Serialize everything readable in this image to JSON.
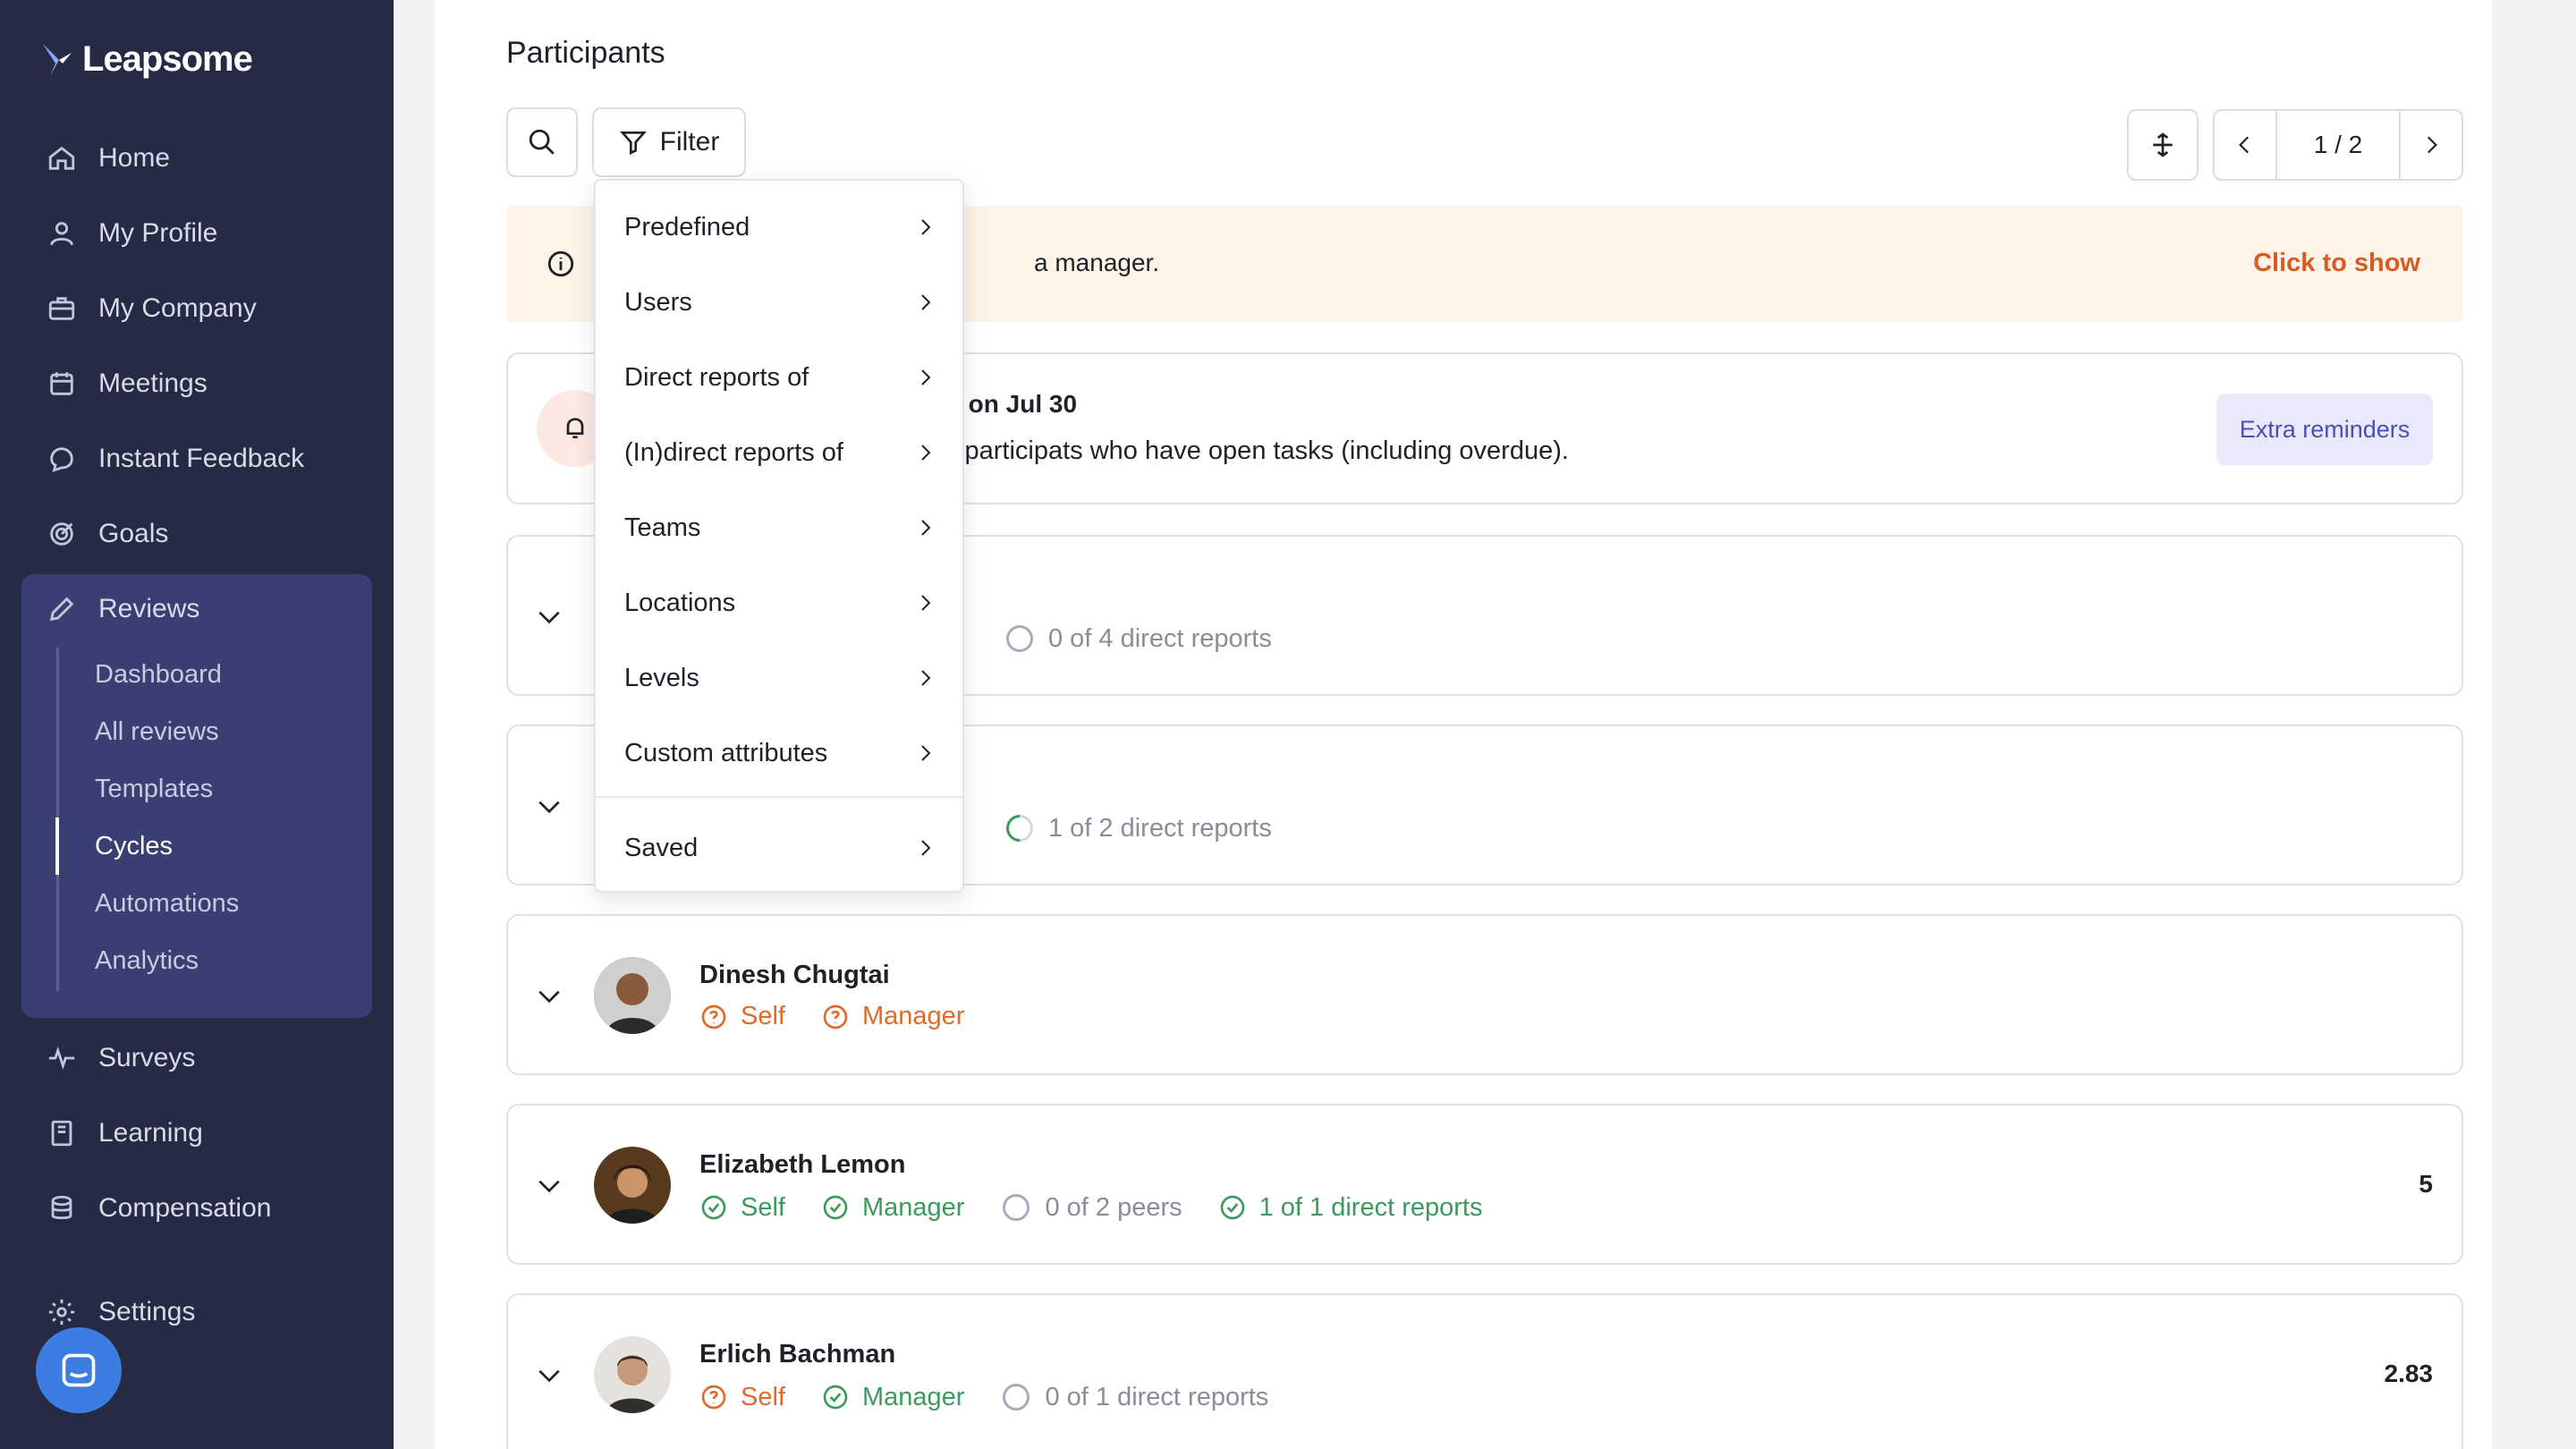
{
  "app": {
    "logo_text": "Leapsome"
  },
  "sidebar": {
    "items": [
      {
        "label": "Home",
        "icon": "home-icon"
      },
      {
        "label": "My Profile",
        "icon": "user-icon"
      },
      {
        "label": "My Company",
        "icon": "briefcase-icon"
      },
      {
        "label": "Meetings",
        "icon": "calendar-icon"
      },
      {
        "label": "Instant Feedback",
        "icon": "chat-icon"
      },
      {
        "label": "Goals",
        "icon": "target-icon"
      },
      {
        "label": "Reviews",
        "icon": "pencil-icon"
      },
      {
        "label": "Surveys",
        "icon": "pulse-icon"
      },
      {
        "label": "Learning",
        "icon": "book-icon"
      },
      {
        "label": "Compensation",
        "icon": "coins-icon"
      },
      {
        "label": "Settings",
        "icon": "gear-icon"
      }
    ],
    "reviews_sub": [
      "Dashboard",
      "All reviews",
      "Templates",
      "Cycles",
      "Automations",
      "Analytics"
    ],
    "active_sub": "Cycles"
  },
  "main": {
    "title": "Participants",
    "filter_label": "Filter",
    "pager": {
      "current": "1 / 2"
    },
    "banner": {
      "text": "a manager.",
      "link": "Click to show"
    },
    "reminder": {
      "title": "r on Jul 30",
      "subtitle": "l participats who have open tasks (including overdue).",
      "button": "Extra reminders"
    },
    "partial_rows": [
      {
        "tag": "0 of 4 direct reports"
      },
      {
        "tag": "1 of 2 direct reports"
      }
    ],
    "participants": [
      {
        "name": "Dinesh Chugtai",
        "tags": [
          {
            "label": "Self",
            "status": "pending"
          },
          {
            "label": "Manager",
            "status": "pending"
          }
        ],
        "score": ""
      },
      {
        "name": "Elizabeth Lemon",
        "tags": [
          {
            "label": "Self",
            "status": "done"
          },
          {
            "label": "Manager",
            "status": "done"
          },
          {
            "label": "0 of 2 peers",
            "status": "empty"
          },
          {
            "label": "1 of 1 direct reports",
            "status": "done"
          }
        ],
        "score": "5"
      },
      {
        "name": "Erlich Bachman",
        "tags": [
          {
            "label": "Self",
            "status": "pending"
          },
          {
            "label": "Manager",
            "status": "done"
          },
          {
            "label": "0 of 1 direct reports",
            "status": "empty"
          }
        ],
        "score": "2.83"
      }
    ]
  },
  "filter_menu": {
    "items": [
      "Predefined",
      "Users",
      "Direct reports of",
      "(In)direct reports of",
      "Teams",
      "Locations",
      "Levels",
      "Custom attributes"
    ],
    "saved": "Saved"
  },
  "colors": {
    "sidebar": "#262a45",
    "reviews_bg": "#3a3f73",
    "accent_orange": "#e06a2c",
    "accent_green": "#3c9a5c",
    "chat": "#3b7de1"
  }
}
